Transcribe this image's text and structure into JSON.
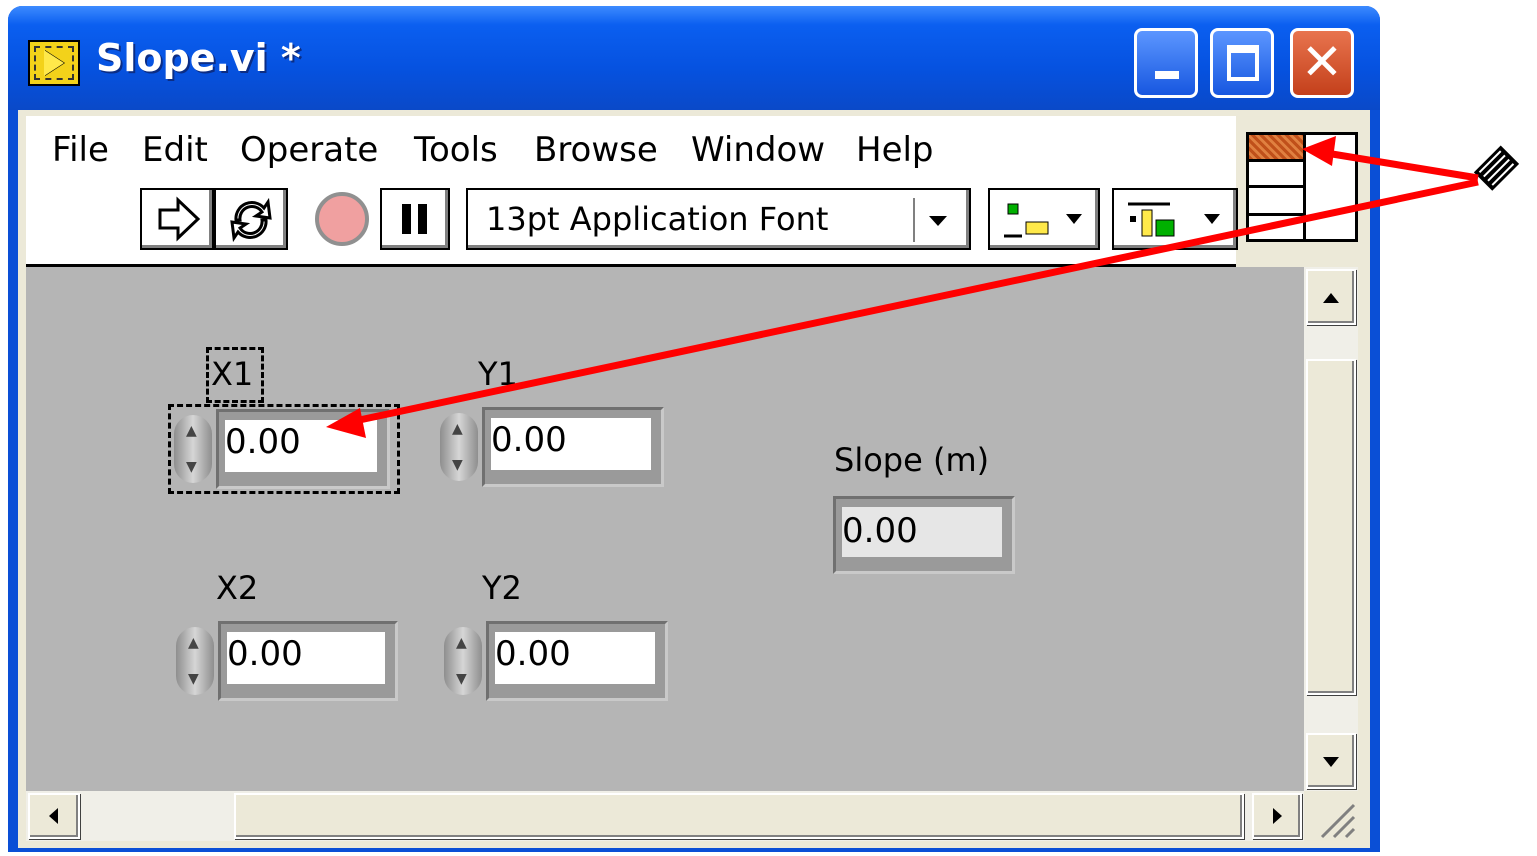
{
  "window": {
    "title": "Slope.vi *",
    "buttons": {
      "minimize": "minimize",
      "maximize": "maximize",
      "close": "close"
    }
  },
  "menu": [
    "File",
    "Edit",
    "Operate",
    "Tools",
    "Browse",
    "Window",
    "Help"
  ],
  "toolbar": {
    "font": "13pt Application Font",
    "buttons": [
      "run",
      "run-continuously",
      "abort",
      "pause",
      "align-objects",
      "distribute-objects"
    ]
  },
  "controls": [
    {
      "label": "X1",
      "value": "0.00"
    },
    {
      "label": "Y1",
      "value": "0.00"
    },
    {
      "label": "X2",
      "value": "0.00"
    },
    {
      "label": "Y2",
      "value": "0.00"
    }
  ],
  "indicator": {
    "label": "Slope (m)",
    "value": "0.00"
  },
  "colors": {
    "titlebar": "#0652e0",
    "panel": "#b5b5b5",
    "arrow": "#ff0000",
    "close": "#d4502a"
  }
}
